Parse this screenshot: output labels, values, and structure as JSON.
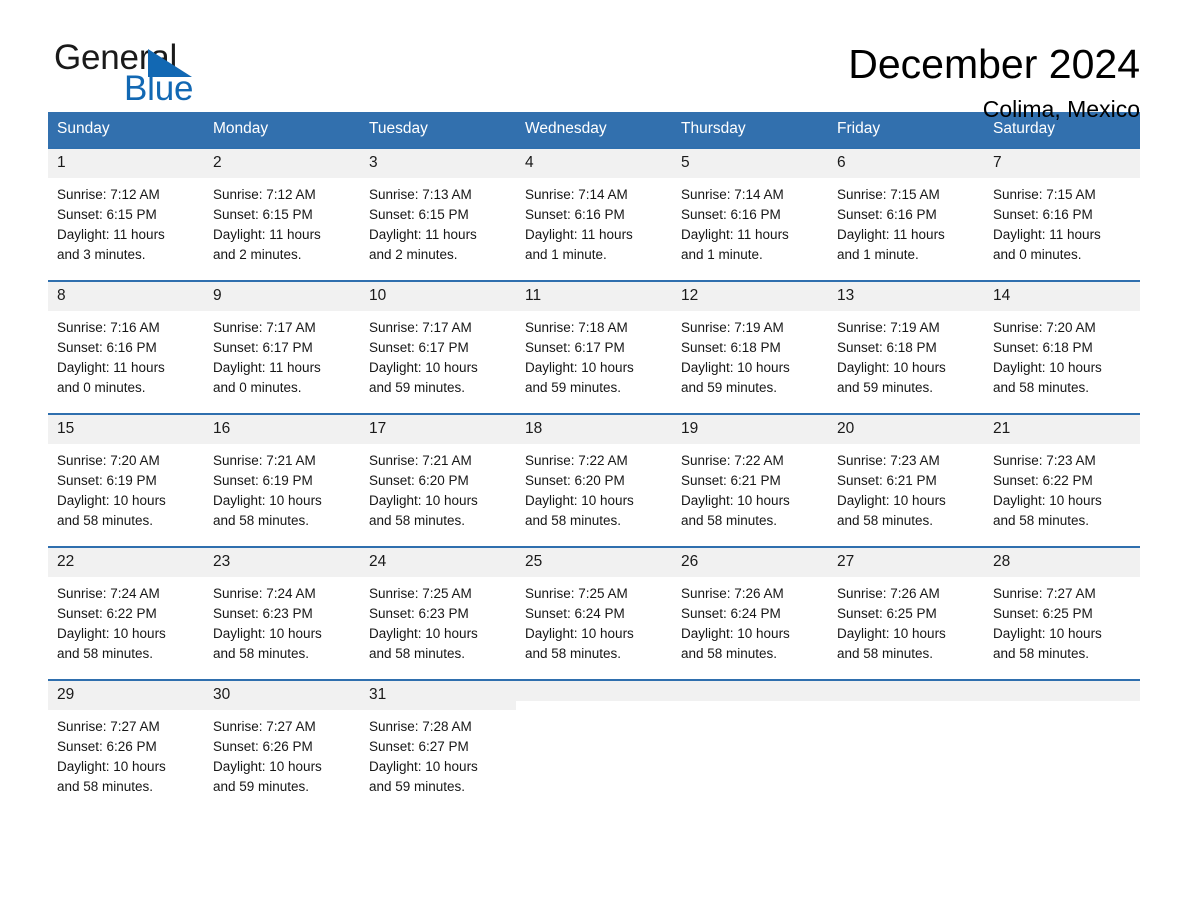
{
  "logo": {
    "word_one": "General",
    "word_two": "Blue",
    "triangle_color": "#1268b3",
    "icon": "triangle-icon"
  },
  "header": {
    "month_title": "December 2024",
    "location": "Colima, Mexico"
  },
  "colors": {
    "header_blue": "#3270ae",
    "row_border_blue": "#2f6fae",
    "daynum_band": "#f1f1f1",
    "brand_blue": "#1268b3"
  },
  "weekday_headers": [
    "Sunday",
    "Monday",
    "Tuesday",
    "Wednesday",
    "Thursday",
    "Friday",
    "Saturday"
  ],
  "weeks": [
    [
      {
        "day": "1",
        "sunrise": "Sunrise: 7:12 AM",
        "sunset": "Sunset: 6:15 PM",
        "daylight_line1": "Daylight: 11 hours",
        "daylight_line2": "and 3 minutes."
      },
      {
        "day": "2",
        "sunrise": "Sunrise: 7:12 AM",
        "sunset": "Sunset: 6:15 PM",
        "daylight_line1": "Daylight: 11 hours",
        "daylight_line2": "and 2 minutes."
      },
      {
        "day": "3",
        "sunrise": "Sunrise: 7:13 AM",
        "sunset": "Sunset: 6:15 PM",
        "daylight_line1": "Daylight: 11 hours",
        "daylight_line2": "and 2 minutes."
      },
      {
        "day": "4",
        "sunrise": "Sunrise: 7:14 AM",
        "sunset": "Sunset: 6:16 PM",
        "daylight_line1": "Daylight: 11 hours",
        "daylight_line2": "and 1 minute."
      },
      {
        "day": "5",
        "sunrise": "Sunrise: 7:14 AM",
        "sunset": "Sunset: 6:16 PM",
        "daylight_line1": "Daylight: 11 hours",
        "daylight_line2": "and 1 minute."
      },
      {
        "day": "6",
        "sunrise": "Sunrise: 7:15 AM",
        "sunset": "Sunset: 6:16 PM",
        "daylight_line1": "Daylight: 11 hours",
        "daylight_line2": "and 1 minute."
      },
      {
        "day": "7",
        "sunrise": "Sunrise: 7:15 AM",
        "sunset": "Sunset: 6:16 PM",
        "daylight_line1": "Daylight: 11 hours",
        "daylight_line2": "and 0 minutes."
      }
    ],
    [
      {
        "day": "8",
        "sunrise": "Sunrise: 7:16 AM",
        "sunset": "Sunset: 6:16 PM",
        "daylight_line1": "Daylight: 11 hours",
        "daylight_line2": "and 0 minutes."
      },
      {
        "day": "9",
        "sunrise": "Sunrise: 7:17 AM",
        "sunset": "Sunset: 6:17 PM",
        "daylight_line1": "Daylight: 11 hours",
        "daylight_line2": "and 0 minutes."
      },
      {
        "day": "10",
        "sunrise": "Sunrise: 7:17 AM",
        "sunset": "Sunset: 6:17 PM",
        "daylight_line1": "Daylight: 10 hours",
        "daylight_line2": "and 59 minutes."
      },
      {
        "day": "11",
        "sunrise": "Sunrise: 7:18 AM",
        "sunset": "Sunset: 6:17 PM",
        "daylight_line1": "Daylight: 10 hours",
        "daylight_line2": "and 59 minutes."
      },
      {
        "day": "12",
        "sunrise": "Sunrise: 7:19 AM",
        "sunset": "Sunset: 6:18 PM",
        "daylight_line1": "Daylight: 10 hours",
        "daylight_line2": "and 59 minutes."
      },
      {
        "day": "13",
        "sunrise": "Sunrise: 7:19 AM",
        "sunset": "Sunset: 6:18 PM",
        "daylight_line1": "Daylight: 10 hours",
        "daylight_line2": "and 59 minutes."
      },
      {
        "day": "14",
        "sunrise": "Sunrise: 7:20 AM",
        "sunset": "Sunset: 6:18 PM",
        "daylight_line1": "Daylight: 10 hours",
        "daylight_line2": "and 58 minutes."
      }
    ],
    [
      {
        "day": "15",
        "sunrise": "Sunrise: 7:20 AM",
        "sunset": "Sunset: 6:19 PM",
        "daylight_line1": "Daylight: 10 hours",
        "daylight_line2": "and 58 minutes."
      },
      {
        "day": "16",
        "sunrise": "Sunrise: 7:21 AM",
        "sunset": "Sunset: 6:19 PM",
        "daylight_line1": "Daylight: 10 hours",
        "daylight_line2": "and 58 minutes."
      },
      {
        "day": "17",
        "sunrise": "Sunrise: 7:21 AM",
        "sunset": "Sunset: 6:20 PM",
        "daylight_line1": "Daylight: 10 hours",
        "daylight_line2": "and 58 minutes."
      },
      {
        "day": "18",
        "sunrise": "Sunrise: 7:22 AM",
        "sunset": "Sunset: 6:20 PM",
        "daylight_line1": "Daylight: 10 hours",
        "daylight_line2": "and 58 minutes."
      },
      {
        "day": "19",
        "sunrise": "Sunrise: 7:22 AM",
        "sunset": "Sunset: 6:21 PM",
        "daylight_line1": "Daylight: 10 hours",
        "daylight_line2": "and 58 minutes."
      },
      {
        "day": "20",
        "sunrise": "Sunrise: 7:23 AM",
        "sunset": "Sunset: 6:21 PM",
        "daylight_line1": "Daylight: 10 hours",
        "daylight_line2": "and 58 minutes."
      },
      {
        "day": "21",
        "sunrise": "Sunrise: 7:23 AM",
        "sunset": "Sunset: 6:22 PM",
        "daylight_line1": "Daylight: 10 hours",
        "daylight_line2": "and 58 minutes."
      }
    ],
    [
      {
        "day": "22",
        "sunrise": "Sunrise: 7:24 AM",
        "sunset": "Sunset: 6:22 PM",
        "daylight_line1": "Daylight: 10 hours",
        "daylight_line2": "and 58 minutes."
      },
      {
        "day": "23",
        "sunrise": "Sunrise: 7:24 AM",
        "sunset": "Sunset: 6:23 PM",
        "daylight_line1": "Daylight: 10 hours",
        "daylight_line2": "and 58 minutes."
      },
      {
        "day": "24",
        "sunrise": "Sunrise: 7:25 AM",
        "sunset": "Sunset: 6:23 PM",
        "daylight_line1": "Daylight: 10 hours",
        "daylight_line2": "and 58 minutes."
      },
      {
        "day": "25",
        "sunrise": "Sunrise: 7:25 AM",
        "sunset": "Sunset: 6:24 PM",
        "daylight_line1": "Daylight: 10 hours",
        "daylight_line2": "and 58 minutes."
      },
      {
        "day": "26",
        "sunrise": "Sunrise: 7:26 AM",
        "sunset": "Sunset: 6:24 PM",
        "daylight_line1": "Daylight: 10 hours",
        "daylight_line2": "and 58 minutes."
      },
      {
        "day": "27",
        "sunrise": "Sunrise: 7:26 AM",
        "sunset": "Sunset: 6:25 PM",
        "daylight_line1": "Daylight: 10 hours",
        "daylight_line2": "and 58 minutes."
      },
      {
        "day": "28",
        "sunrise": "Sunrise: 7:27 AM",
        "sunset": "Sunset: 6:25 PM",
        "daylight_line1": "Daylight: 10 hours",
        "daylight_line2": "and 58 minutes."
      }
    ],
    [
      {
        "day": "29",
        "sunrise": "Sunrise: 7:27 AM",
        "sunset": "Sunset: 6:26 PM",
        "daylight_line1": "Daylight: 10 hours",
        "daylight_line2": "and 58 minutes."
      },
      {
        "day": "30",
        "sunrise": "Sunrise: 7:27 AM",
        "sunset": "Sunset: 6:26 PM",
        "daylight_line1": "Daylight: 10 hours",
        "daylight_line2": "and 59 minutes."
      },
      {
        "day": "31",
        "sunrise": "Sunrise: 7:28 AM",
        "sunset": "Sunset: 6:27 PM",
        "daylight_line1": "Daylight: 10 hours",
        "daylight_line2": "and 59 minutes."
      },
      {
        "day": "",
        "sunrise": "",
        "sunset": "",
        "daylight_line1": "",
        "daylight_line2": ""
      },
      {
        "day": "",
        "sunrise": "",
        "sunset": "",
        "daylight_line1": "",
        "daylight_line2": ""
      },
      {
        "day": "",
        "sunrise": "",
        "sunset": "",
        "daylight_line1": "",
        "daylight_line2": ""
      },
      {
        "day": "",
        "sunrise": "",
        "sunset": "",
        "daylight_line1": "",
        "daylight_line2": ""
      }
    ]
  ]
}
